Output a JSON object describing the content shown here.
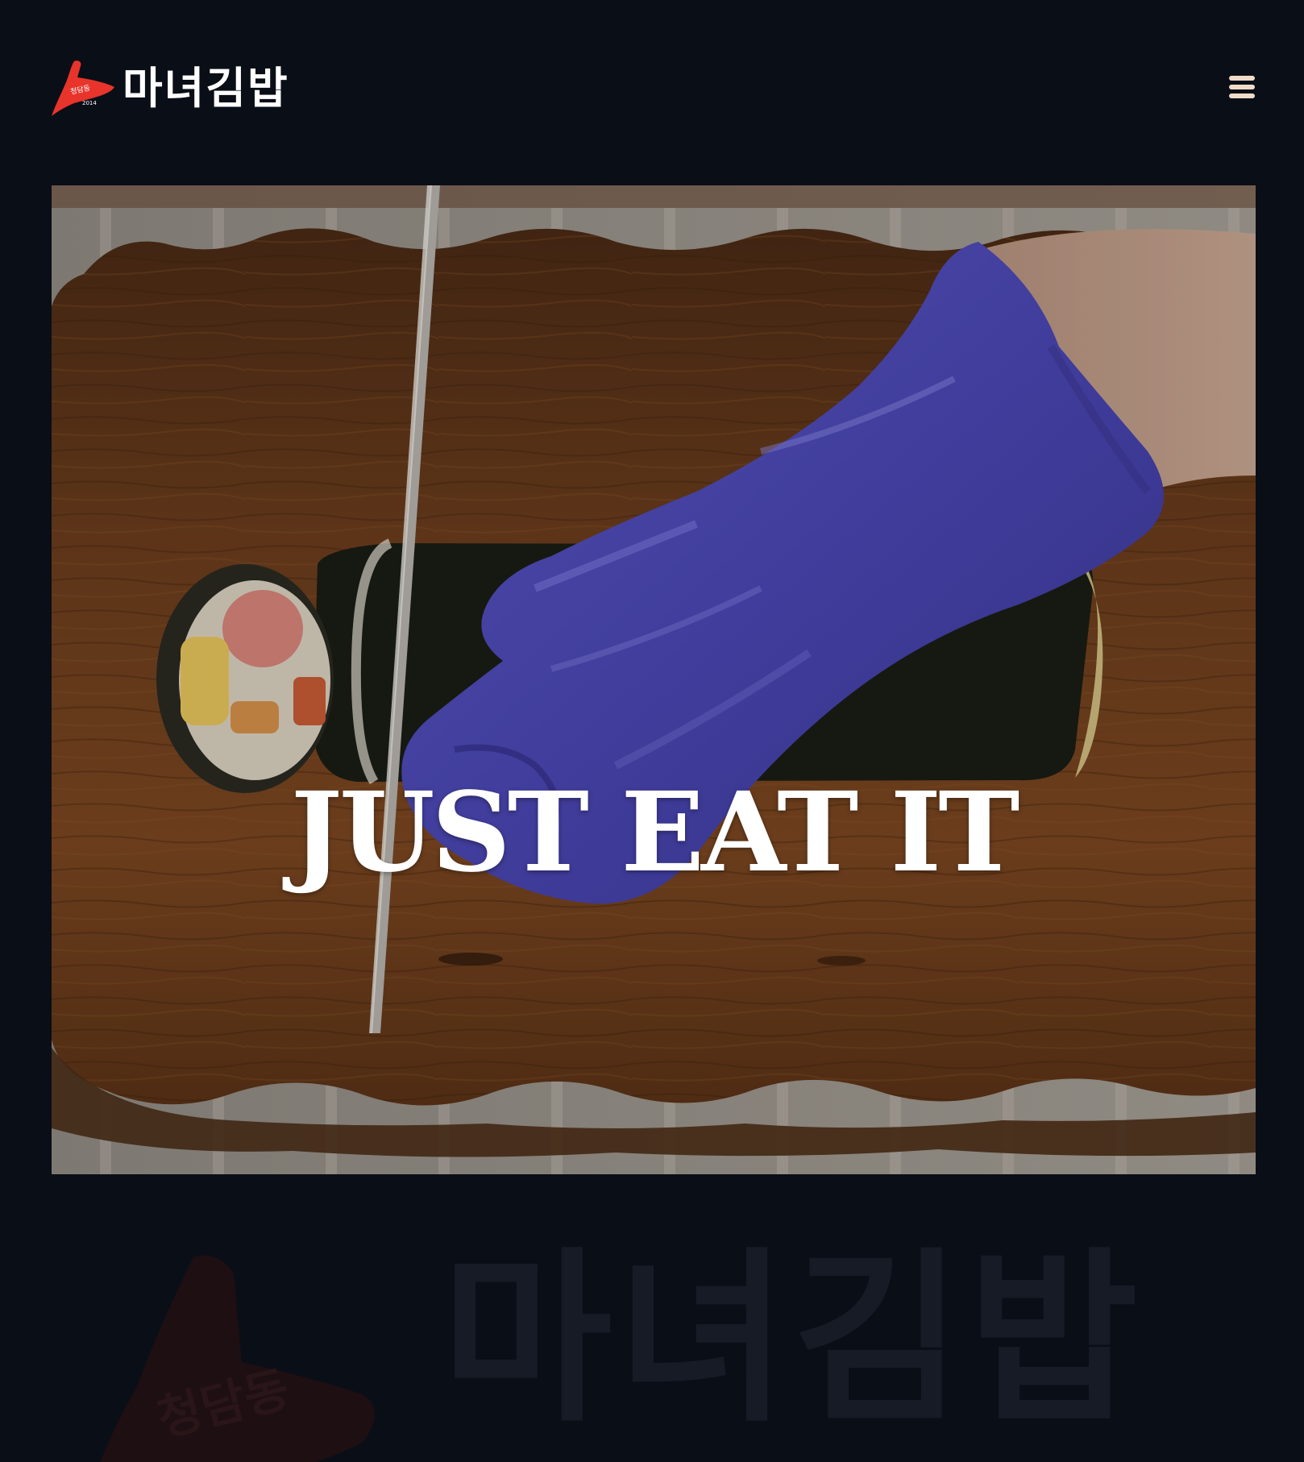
{
  "header": {
    "brand": {
      "name": "마녀김밥",
      "hat_text": "청담동",
      "hat_year": "2014"
    },
    "menu_icon": "hamburger-menu-icon"
  },
  "hero": {
    "title": "JUST EAT IT"
  },
  "watermark": {
    "name": "마녀김밥",
    "hat_text": "청담동"
  },
  "colors": {
    "background": "#0a0e17",
    "brand_red": "#e8342b",
    "menu_icon": "#f1dcc8"
  }
}
